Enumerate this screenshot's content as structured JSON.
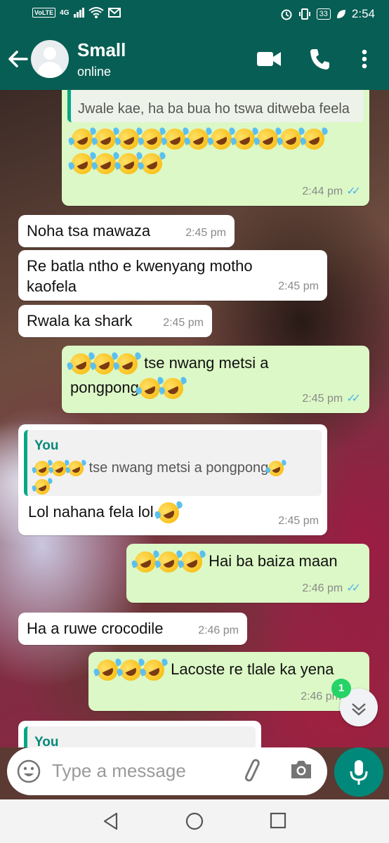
{
  "status_bar": {
    "network": "VoLTE",
    "network_type": "4G",
    "battery": "33",
    "time": "2:54"
  },
  "header": {
    "contact_name": "Small",
    "contact_status": "online"
  },
  "messages": [
    {
      "side": "out",
      "quote_text": "Jwale kae, ha ba bua ho tswa ditweba feela",
      "emoji_rows": [
        11,
        4
      ],
      "time": "2:44 pm"
    },
    {
      "side": "in",
      "text": "Noha tsa mawaza",
      "time": "2:45 pm"
    },
    {
      "side": "in",
      "text": "Re batla ntho e kwenyang motho kaofela",
      "time": "2:45 pm"
    },
    {
      "side": "in",
      "text": "Rwala ka shark",
      "time": "2:45 pm"
    },
    {
      "side": "out",
      "text_line1": "tse nwang metsi a",
      "text_line2": "pongpong",
      "time": "2:45 pm"
    },
    {
      "side": "in",
      "quote_author": "You",
      "quote_text": "tse nwang metsi a pongpong",
      "text": "Lol nahana fela lol",
      "time": "2:45 pm"
    },
    {
      "side": "out",
      "text": "Hai ba baiza maan",
      "time": "2:46 pm"
    },
    {
      "side": "in",
      "text": "Ha a ruwe crocodile",
      "time": "2:46 pm"
    },
    {
      "side": "out",
      "text": "Lacoste re tlale ka yena",
      "time": "2:46 pm"
    },
    {
      "side": "in",
      "quote_author": "You"
    }
  ],
  "scroll": {
    "unread_count": "1"
  },
  "composer": {
    "placeholder": "Type a message"
  },
  "colors": {
    "header": "#075e54",
    "outgoing_bubble": "#dcf8c6",
    "incoming_bubble": "#ffffff",
    "mic_button": "#00897b",
    "read_tick": "#4fb6ec"
  },
  "icons": [
    "back-arrow-icon",
    "video-call-icon",
    "voice-call-icon",
    "more-options-icon",
    "emoji-icon",
    "attach-icon",
    "camera-icon",
    "mic-icon",
    "chevron-down-icon",
    "nav-back-icon",
    "nav-home-icon",
    "nav-recents-icon"
  ]
}
